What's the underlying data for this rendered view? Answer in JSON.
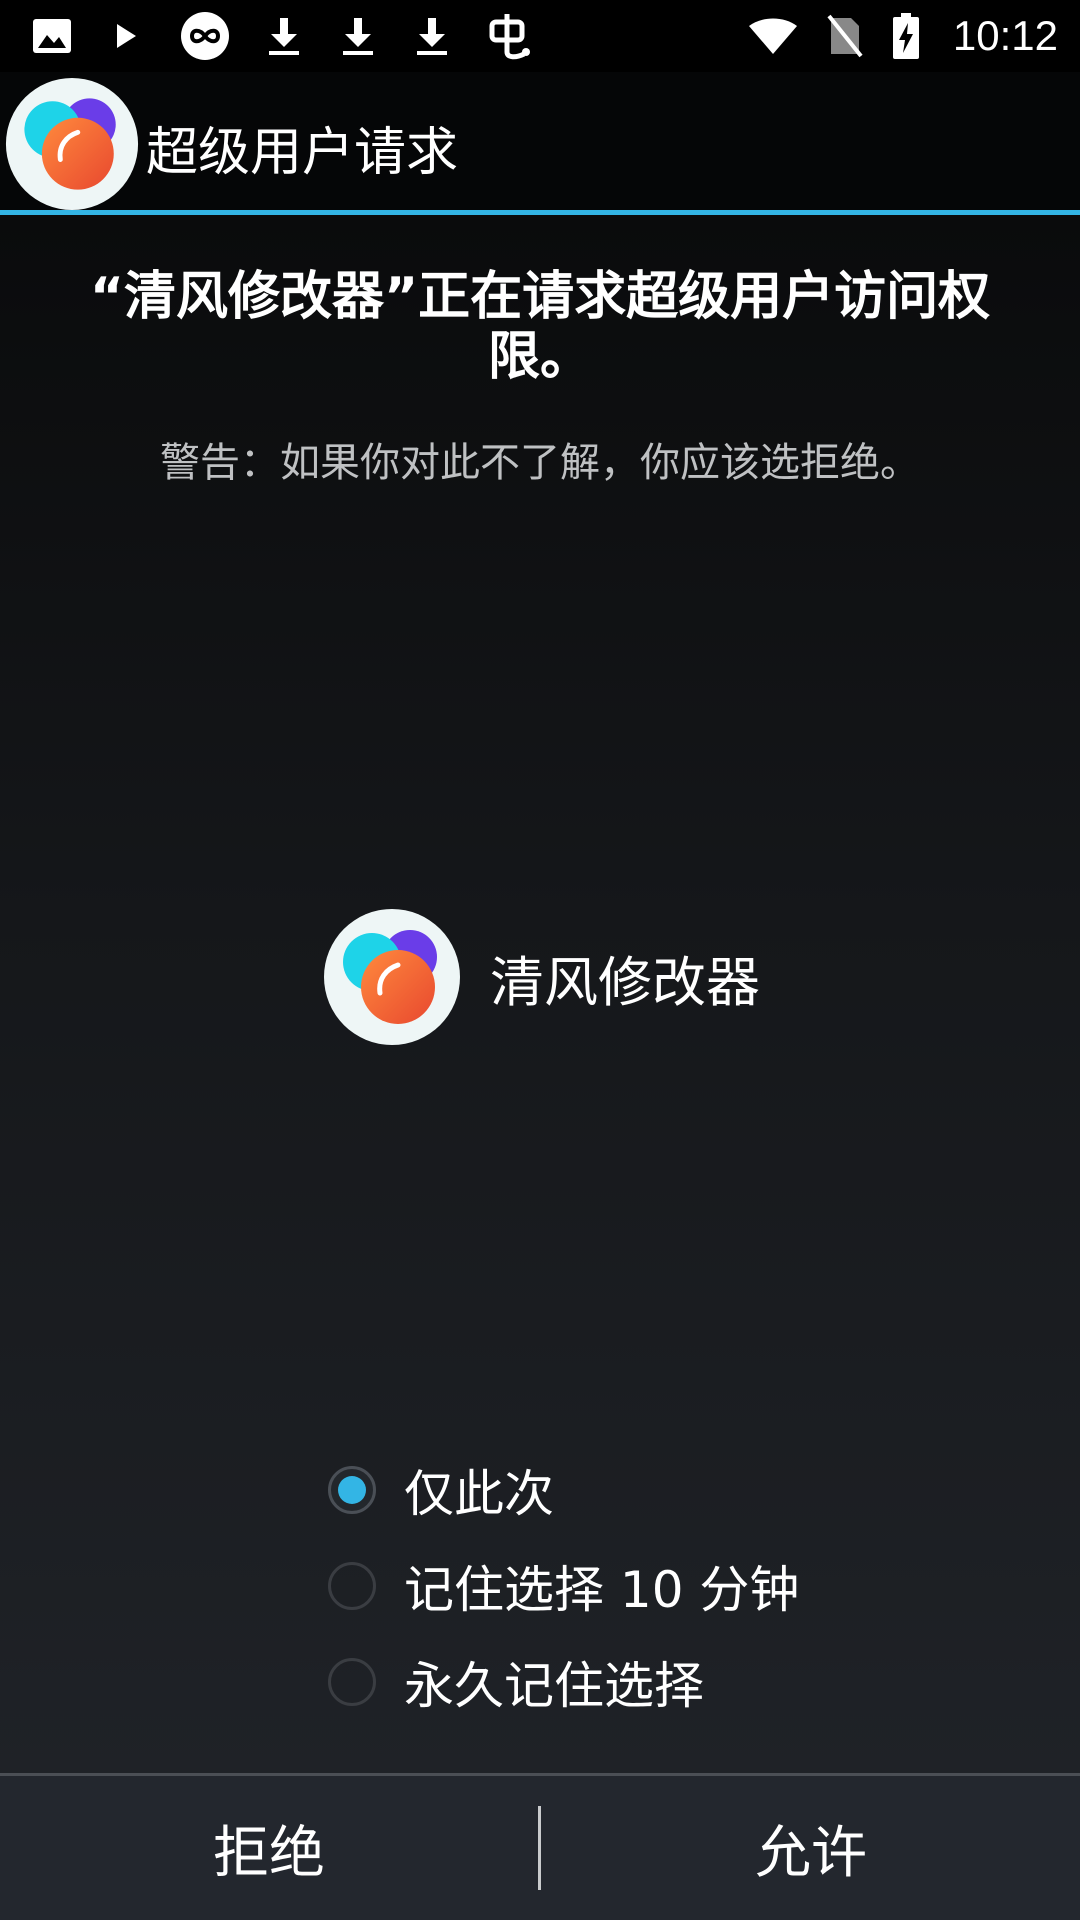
{
  "status_bar": {
    "time": "10:12",
    "left_icons": [
      "image-icon",
      "play-icon",
      "infinity-circle-icon",
      "download-icon",
      "download-icon",
      "download-icon",
      "bug-icon"
    ],
    "right_icons": [
      "wifi-icon",
      "no-sim-icon",
      "battery-charging-icon"
    ]
  },
  "title_bar": {
    "title": "超级用户请求",
    "accent_color": "#33b5e5"
  },
  "request": {
    "title": "“清风修改器”正在请求超级用户访问权限。",
    "warning": "警告：如果你对此不了解，你应该选拒绝。"
  },
  "app": {
    "name": "清风修改器",
    "icon": "app-logo-icon"
  },
  "options": [
    {
      "label": "仅此次",
      "checked": true
    },
    {
      "label": "记住选择 10 分钟",
      "checked": false
    },
    {
      "label": "永久记住选择",
      "checked": false
    }
  ],
  "buttons": {
    "deny": "拒绝",
    "allow": "允许"
  }
}
